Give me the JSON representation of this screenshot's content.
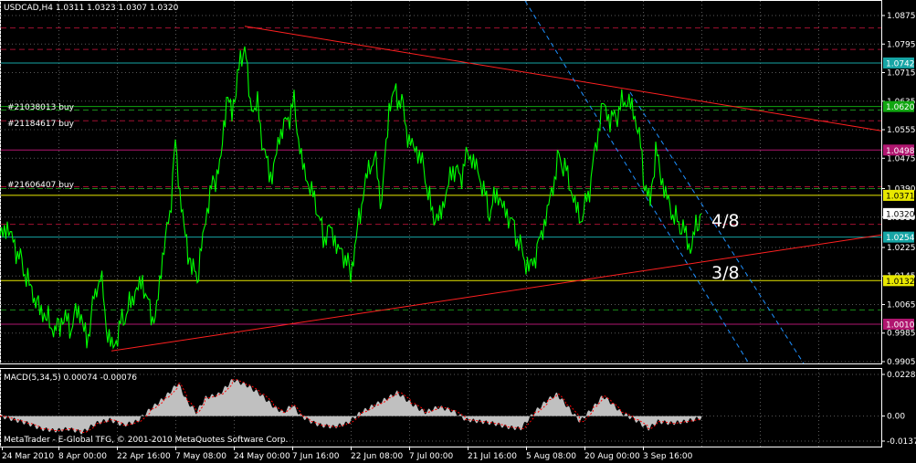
{
  "chart_data": {
    "type": "line",
    "title": "USDCAD,H4  1.0311 1.0323 1.0307 1.0320",
    "price_ylim": [
      0.9905,
      1.0875
    ],
    "price_ticks": [
      "1.0875",
      "1.0795",
      "1.0715",
      "1.0635",
      "1.0555",
      "1.0475",
      "1.0390",
      "1.0310",
      "1.0225",
      "1.0145",
      "1.0065",
      "0.9985",
      "0.9905"
    ],
    "current_price": "1.0320",
    "levels": [
      {
        "value": 1.0742,
        "label": "1.0742",
        "color": "#16a5a5"
      },
      {
        "value": 1.062,
        "label": "1.0620",
        "color": "#11a611"
      },
      {
        "value": 1.0498,
        "label": "1.0498",
        "color": "#b0166f"
      },
      {
        "value": 1.0371,
        "label": "1.0371",
        "color": "#e8e800"
      },
      {
        "value": 1.0254,
        "label": "1.0254",
        "color": "#16a5a5"
      },
      {
        "value": 1.0132,
        "label": "1.0132",
        "color": "#e8e800"
      },
      {
        "value": 1.001,
        "label": "1.0010",
        "color": "#b0166f"
      }
    ],
    "order_labels": [
      "#21038013 buy",
      "#21184617 buy",
      "#21606407 buy"
    ],
    "annotations": [
      "4/8",
      "3/8"
    ],
    "x_labels": [
      "24 Mar 2010",
      "8 Apr 00:00",
      "22 Apr 16:00",
      "7 May 08:00",
      "24 May 00:00",
      "7 Jun 16:00",
      "22 Jun 08:00",
      "7 Jul 00:00",
      "21 Jul 16:00",
      "5 Aug 08:00",
      "20 Aug 00:00",
      "3 Sep 16:00"
    ],
    "price_path": [
      [
        0,
        1.025
      ],
      [
        8,
        1.0285
      ],
      [
        16,
        1.023
      ],
      [
        24,
        1.018
      ],
      [
        32,
        1.012
      ],
      [
        42,
        1.006
      ],
      [
        50,
        1.003
      ],
      [
        60,
        0.999
      ],
      [
        70,
        1.003
      ],
      [
        78,
        1.0
      ],
      [
        86,
        1.006
      ],
      [
        95,
        0.996
      ],
      [
        103,
        1.008
      ],
      [
        110,
        1.015
      ],
      [
        118,
        0.998
      ],
      [
        124,
        0.994
      ],
      [
        132,
        1.001
      ],
      [
        140,
        1.005
      ],
      [
        148,
        1.01
      ],
      [
        156,
        1.013
      ],
      [
        164,
        1.005
      ],
      [
        170,
        1.002
      ],
      [
        178,
        1.02
      ],
      [
        186,
        1.032
      ],
      [
        192,
        1.052
      ],
      [
        197,
        1.038
      ],
      [
        203,
        1.025
      ],
      [
        210,
        1.017
      ],
      [
        216,
        1.014
      ],
      [
        222,
        1.025
      ],
      [
        230,
        1.038
      ],
      [
        236,
        1.042
      ],
      [
        242,
        1.047
      ],
      [
        248,
        1.065
      ],
      [
        254,
        1.06
      ],
      [
        260,
        1.07
      ],
      [
        268,
        1.08
      ],
      [
        274,
        1.062
      ],
      [
        282,
        1.062
      ],
      [
        290,
        1.048
      ],
      [
        298,
        1.042
      ],
      [
        306,
        1.054
      ],
      [
        314,
        1.058
      ],
      [
        322,
        1.063
      ],
      [
        330,
        1.047
      ],
      [
        338,
        1.04
      ],
      [
        346,
        1.035
      ],
      [
        354,
        1.025
      ],
      [
        362,
        1.028
      ],
      [
        370,
        1.022
      ],
      [
        378,
        1.02
      ],
      [
        384,
        1.015
      ],
      [
        390,
        1.025
      ],
      [
        396,
        1.035
      ],
      [
        402,
        1.043
      ],
      [
        410,
        1.048
      ],
      [
        418,
        1.035
      ],
      [
        426,
        1.062
      ],
      [
        432,
        1.066
      ],
      [
        440,
        1.063
      ],
      [
        448,
        1.052
      ],
      [
        456,
        1.05
      ],
      [
        464,
        1.045
      ],
      [
        472,
        1.033
      ],
      [
        480,
        1.03
      ],
      [
        488,
        1.037
      ],
      [
        496,
        1.045
      ],
      [
        504,
        1.042
      ],
      [
        512,
        1.049
      ],
      [
        520,
        1.046
      ],
      [
        528,
        1.04
      ],
      [
        536,
        1.032
      ],
      [
        544,
        1.038
      ],
      [
        552,
        1.033
      ],
      [
        560,
        1.03
      ],
      [
        568,
        1.024
      ],
      [
        576,
        1.018
      ],
      [
        582,
        1.017
      ],
      [
        588,
        1.022
      ],
      [
        596,
        1.029
      ],
      [
        604,
        1.038
      ],
      [
        612,
        1.048
      ],
      [
        620,
        1.044
      ],
      [
        628,
        1.036
      ],
      [
        636,
        1.03
      ],
      [
        644,
        1.037
      ],
      [
        652,
        1.05
      ],
      [
        660,
        1.063
      ],
      [
        668,
        1.058
      ],
      [
        676,
        1.06
      ],
      [
        684,
        1.064
      ],
      [
        692,
        1.062
      ],
      [
        700,
        1.054
      ],
      [
        706,
        1.04
      ],
      [
        712,
        1.035
      ],
      [
        718,
        1.05
      ],
      [
        724,
        1.042
      ],
      [
        732,
        1.035
      ],
      [
        740,
        1.03
      ],
      [
        748,
        1.028
      ],
      [
        756,
        1.022
      ],
      [
        762,
        1.028
      ],
      [
        768,
        1.032
      ]
    ],
    "macd": {
      "label": "MACD(5,34,5) 0.00074 -0.00076",
      "ylim": [
        -0.01375,
        0.02286
      ],
      "ticks": [
        "0.02286",
        "0.00",
        "-0.01375"
      ],
      "values": [
        [
          0,
          0.0
        ],
        [
          15,
          -0.002
        ],
        [
          30,
          -0.004
        ],
        [
          45,
          -0.007
        ],
        [
          60,
          -0.008
        ],
        [
          75,
          -0.007
        ],
        [
          90,
          -0.009
        ],
        [
          105,
          -0.004
        ],
        [
          120,
          -0.002
        ],
        [
          135,
          -0.005
        ],
        [
          150,
          -0.003
        ],
        [
          165,
          0.004
        ],
        [
          180,
          0.01
        ],
        [
          195,
          0.018
        ],
        [
          205,
          0.008
        ],
        [
          215,
          0.002
        ],
        [
          225,
          0.01
        ],
        [
          240,
          0.012
        ],
        [
          255,
          0.02
        ],
        [
          270,
          0.017
        ],
        [
          285,
          0.012
        ],
        [
          300,
          0.005
        ],
        [
          310,
          0.002
        ],
        [
          320,
          0.006
        ],
        [
          330,
          0.0
        ],
        [
          340,
          -0.003
        ],
        [
          350,
          -0.005
        ],
        [
          365,
          -0.006
        ],
        [
          380,
          -0.004
        ],
        [
          395,
          0.002
        ],
        [
          410,
          0.006
        ],
        [
          425,
          0.01
        ],
        [
          435,
          0.013
        ],
        [
          450,
          0.007
        ],
        [
          465,
          0.002
        ],
        [
          480,
          0.005
        ],
        [
          495,
          0.003
        ],
        [
          510,
          -0.002
        ],
        [
          525,
          -0.003
        ],
        [
          540,
          -0.004
        ],
        [
          555,
          -0.006
        ],
        [
          570,
          -0.007
        ],
        [
          585,
          0.002
        ],
        [
          600,
          0.009
        ],
        [
          610,
          0.012
        ],
        [
          620,
          0.006
        ],
        [
          635,
          -0.003
        ],
        [
          650,
          0.005
        ],
        [
          660,
          0.011
        ],
        [
          670,
          0.007
        ],
        [
          680,
          0.002
        ],
        [
          695,
          -0.002
        ],
        [
          710,
          -0.007
        ],
        [
          720,
          -0.003
        ],
        [
          735,
          -0.004
        ],
        [
          750,
          -0.003
        ],
        [
          768,
          -0.001
        ]
      ]
    },
    "grid": true,
    "colors": {
      "background": "#000000",
      "price": "#00ff00",
      "grid": "#5a5a5a",
      "trend": "#ff2020",
      "channel": "#1e90ff",
      "macd_fill": "#c0c0c0",
      "macd_signal": "#ff0000",
      "axis": "#ffffff"
    }
  },
  "footer": {
    "copyright": "MetaTrader - E-Global TFG, © 2001-2010 MetaQuotes Software Corp."
  }
}
